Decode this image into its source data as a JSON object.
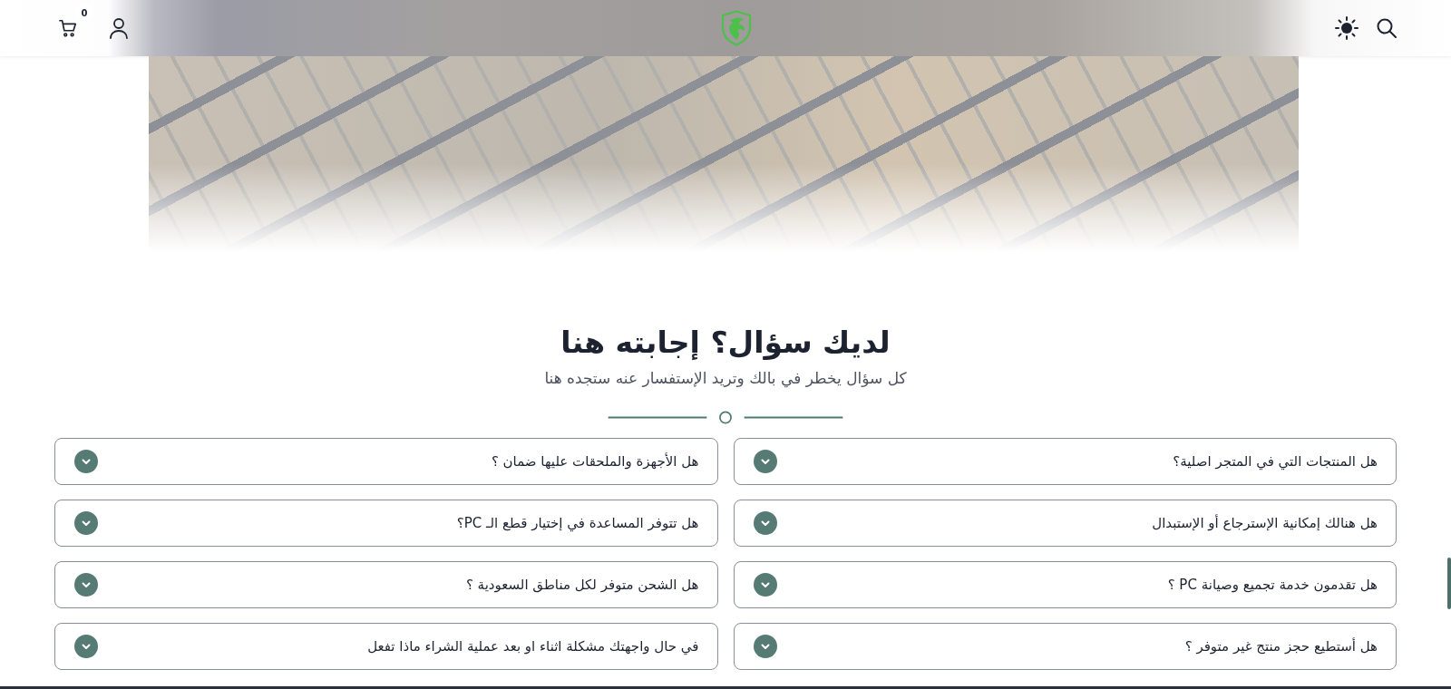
{
  "header": {
    "cart_count": "0"
  },
  "faq_section": {
    "title": "لديك سؤال؟ إجابته هنا",
    "subtitle": "كل سؤال يخطر في بالك وتريد الإستفسار عنه ستجده هنا",
    "questions": [
      {
        "text": "هل المنتجات التي في المتجر اصلية؟",
        "expanded": false
      },
      {
        "text": "هل الأجهزة والملحقات عليها ضمان ؟",
        "expanded": false
      },
      {
        "text": "هل هنالك إمكانية الإسترجاع أو الإستبدال",
        "expanded": false
      },
      {
        "text": "هل تتوفر المساعدة في إختيار قطع الـ PC؟",
        "expanded": false
      },
      {
        "text": "هل تقدمون خدمة تجميع وصيانة PC ؟",
        "expanded": false
      },
      {
        "text": "هل الشحن متوفر لكل مناطق السعودية ؟",
        "expanded": false
      },
      {
        "text": "هل أستطيع حجز منتج غير متوفر ؟",
        "expanded": false
      },
      {
        "text": "في حال واجهتك مشكلة اثناء او بعد عملية الشراء ماذا تفعل",
        "expanded": false
      }
    ]
  }
}
